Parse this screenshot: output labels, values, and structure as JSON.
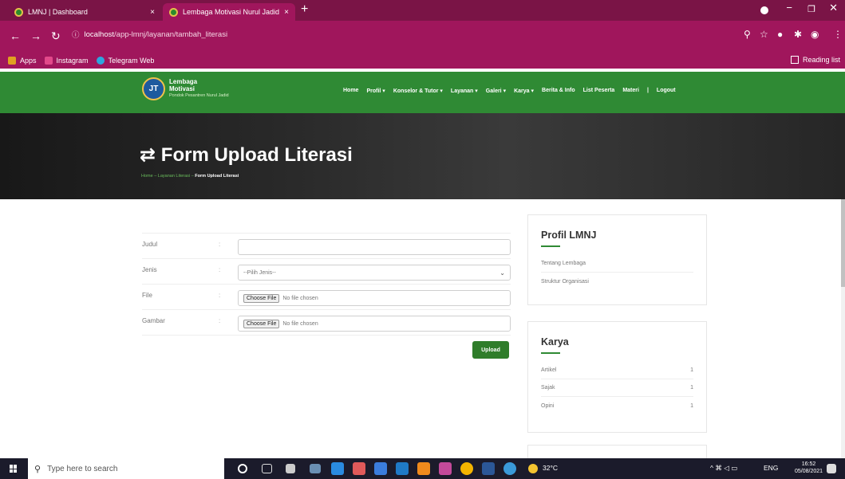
{
  "browser": {
    "tabs": [
      {
        "title": "LMNJ | Dashboard",
        "close": "×"
      },
      {
        "title": "Lembaga Motivasi Nurul Jadid - [",
        "close": "×"
      }
    ],
    "new_tab": "+",
    "url_host": "localhost",
    "url_path": "/app-lmnj/layanan/tambah_literasi",
    "bookmarks": [
      "Apps",
      "Instagram",
      "Telegram Web"
    ],
    "reading_list": "Reading list",
    "colors": {
      "frame": "#7a1446",
      "toolbar": "#a0165c"
    }
  },
  "site": {
    "logo_line1": "Lembaga",
    "logo_line2": "Motivasi",
    "logo_sub": "Pondok Pesantren Nurul Jadid",
    "logo_mark": "JT",
    "menu": [
      "Home",
      "Profil ▾",
      "Konselor & Tutor ▾",
      "Layanan ▾",
      "Galeri ▾",
      "Karya ▾",
      "Berita & Info",
      "List Peserta",
      "Materi",
      "|",
      "Logout"
    ],
    "colors": {
      "nav": "#2f8a34",
      "button": "#2f7d2a"
    }
  },
  "hero": {
    "title": "Form Upload Literasi",
    "crumb_home": "Home",
    "crumb_mid": "Layanan Literasi",
    "crumb_current": "Form Upload Literasi"
  },
  "form": {
    "fields": [
      {
        "label": "Judul",
        "colon": ":",
        "value": ""
      },
      {
        "label": "Jenis",
        "colon": ":",
        "value": "--Pilih Jenis--"
      },
      {
        "label": "File",
        "colon": ":",
        "button": "Choose File",
        "value": "No file chosen"
      },
      {
        "label": "Gambar",
        "colon": ":",
        "button": "Choose File",
        "value": "No file chosen"
      }
    ],
    "submit": "Upload"
  },
  "sidebar": {
    "profil": {
      "title": "Profil LMNJ",
      "items": [
        "Tentang Lembaga",
        "Struktur Organisasi"
      ]
    },
    "karya": {
      "title": "Karya",
      "items": [
        {
          "label": "Artikel",
          "count": "1"
        },
        {
          "label": "Sajak",
          "count": "1"
        },
        {
          "label": "Opini",
          "count": "1"
        }
      ]
    }
  },
  "taskbar": {
    "search_placeholder": "Type here to search",
    "temperature": "32°C",
    "language": "ENG",
    "time": "16:52",
    "date": "05/08/2021"
  }
}
